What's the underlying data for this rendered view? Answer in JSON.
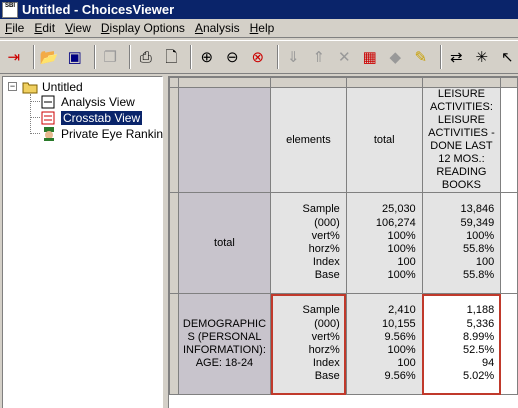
{
  "window": {
    "title": "Untitled - ChoicesViewer",
    "icon_text": "SBI"
  },
  "menu": [
    {
      "label": "File",
      "u": "F",
      "rest": "ile"
    },
    {
      "label": "Edit",
      "u": "E",
      "rest": "dit"
    },
    {
      "label": "View",
      "u": "V",
      "rest": "iew"
    },
    {
      "label": "Display Options",
      "u": "D",
      "rest": "isplay Options"
    },
    {
      "label": "Analysis",
      "u": "A",
      "rest": "nalysis"
    },
    {
      "label": "Help",
      "u": "H",
      "rest": "elp"
    }
  ],
  "toolbar_icons": [
    "exit-icon",
    "open-folder-icon",
    "save-icon",
    "copy-icon",
    "print-icon",
    "print-preview-icon",
    "zoom-in-icon",
    "zoom-out-icon",
    "zoom-reset-icon",
    "sort-descending-icon",
    "sort-ascending-icon",
    "remove-column-icon",
    "table-icon",
    "filter-icon",
    "highlight-icon",
    "swap-axes-icon",
    "sparkle-icon",
    "back-arrow-icon"
  ],
  "tree": {
    "root": "Untitled",
    "children": [
      "Analysis View",
      "Crosstab View",
      "Private Eye Ranking V"
    ],
    "selected": "Crosstab View"
  },
  "crosstab": {
    "col_headers": [
      "elements",
      "total",
      "LEISURE ACTIVITIES: LEISURE ACTIVITIES - DONE LAST 12 MOS.: READING BOOKS"
    ],
    "stat_labels": [
      "Sample",
      "(000)",
      "vert%",
      "horz%",
      "Index",
      "Base"
    ],
    "rows": [
      {
        "label": "total",
        "total": [
          "25,030",
          "106,274",
          "100%",
          "100%",
          "100",
          "100%"
        ],
        "reading": [
          "13,846",
          "59,349",
          "100%",
          "55.8%",
          "100",
          "55.8%"
        ]
      },
      {
        "label": "DEMOGRAPHIC S (PERSONAL INFORMATION): AGE: 18-24",
        "total": [
          "2,410",
          "10,155",
          "9.56%",
          "100%",
          "100",
          "9.56%"
        ],
        "reading": [
          "1,188",
          "5,336",
          "8.99%",
          "52.5%",
          "94",
          "5.02%"
        ]
      }
    ]
  }
}
